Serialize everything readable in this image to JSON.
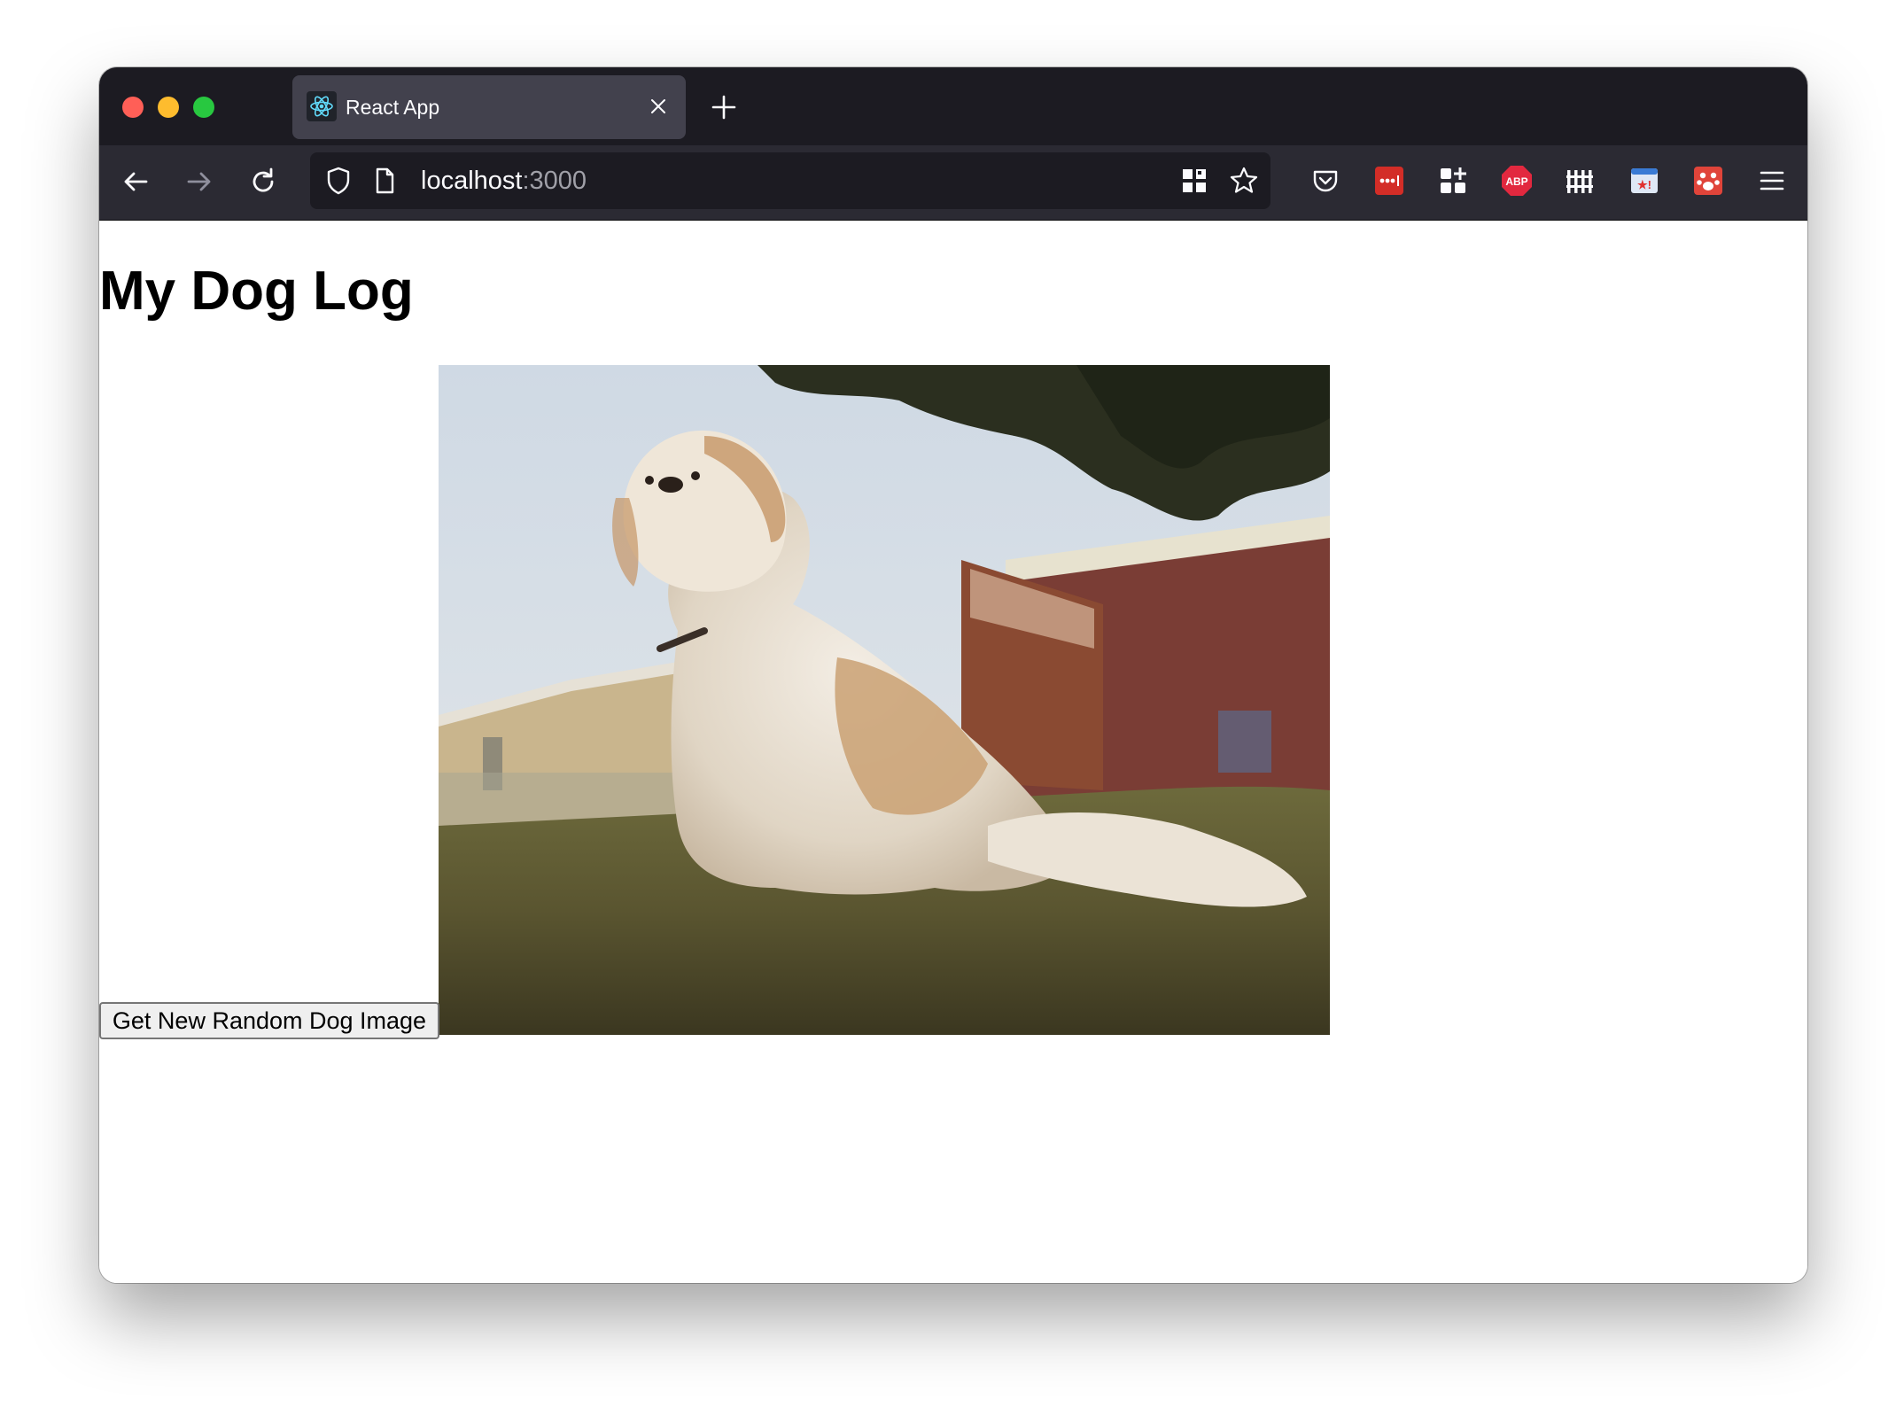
{
  "browser": {
    "tab": {
      "title": "React App",
      "favicon": "react-logo-icon",
      "close_icon": "close-icon"
    },
    "new_tab_icon": "plus-icon",
    "nav": {
      "back_icon": "back-arrow-icon",
      "forward_icon": "forward-arrow-icon",
      "reload_icon": "reload-icon"
    },
    "url": {
      "host": "localhost",
      "port": ":3000",
      "shield_icon": "shield-icon",
      "page_icon": "page-icon",
      "qr_icon": "qr-code-icon",
      "bookmark_icon": "star-icon"
    },
    "toolbar_icons": [
      "pocket-icon",
      "lastpass-icon",
      "extensions-grid-icon",
      "adblock-plus-icon",
      "fence-icon",
      "calendar-star-icon",
      "paw-extension-icon",
      "hamburger-menu-icon"
    ],
    "colors": {
      "tabstrip": "#1c1b22",
      "navbar": "#2b2a33",
      "active_tab": "#42414d",
      "urlbar": "#1c1b22",
      "traffic_red": "#ff5f57",
      "traffic_yellow": "#febc2e",
      "traffic_green": "#28c840"
    }
  },
  "page": {
    "title": "My Dog Log",
    "button_label": "Get New Random Dog Image",
    "image_alt": "Shih Tzu dog sitting on grass"
  }
}
